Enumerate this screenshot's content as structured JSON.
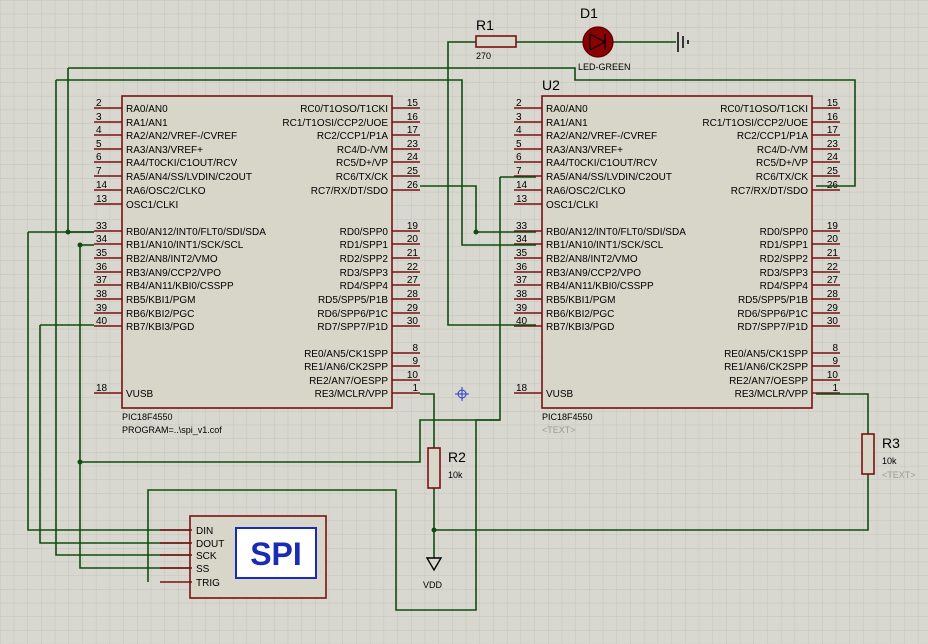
{
  "colors": {
    "background": "#d8d8d0",
    "grid": "#c2c3b8",
    "wire": "#0f4d0f",
    "component_outline": "#7a1010",
    "component_fill": "#d7d6c9",
    "led": "#8b0000",
    "spi_text": "#1a2bb5"
  },
  "u1": {
    "ref": "",
    "part": "PIC18F4550",
    "program": "PROGRAM=..\\spi_v1.cof",
    "left_pins": [
      {
        "num": "2",
        "label": "RA0/AN0"
      },
      {
        "num": "3",
        "label": "RA1/AN1"
      },
      {
        "num": "4",
        "label": "RA2/AN2/VREF-/CVREF"
      },
      {
        "num": "5",
        "label": "RA3/AN3/VREF+"
      },
      {
        "num": "6",
        "label": "RA4/T0CKI/C1OUT/RCV"
      },
      {
        "num": "7",
        "label": "RA5/AN4/SS/LVDIN/C2OUT"
      },
      {
        "num": "14",
        "label": "RA6/OSC2/CLKO"
      },
      {
        "num": "13",
        "label": "OSC1/CLKI"
      },
      {
        "num": "33",
        "label": "RB0/AN12/INT0/FLT0/SDI/SDA"
      },
      {
        "num": "34",
        "label": "RB1/AN10/INT1/SCK/SCL"
      },
      {
        "num": "35",
        "label": "RB2/AN8/INT2/VMO"
      },
      {
        "num": "36",
        "label": "RB3/AN9/CCP2/VPO"
      },
      {
        "num": "37",
        "label": "RB4/AN11/KBI0/CSSPP"
      },
      {
        "num": "38",
        "label": "RB5/KBI1/PGM"
      },
      {
        "num": "39",
        "label": "RB6/KBI2/PGC"
      },
      {
        "num": "40",
        "label": "RB7/KBI3/PGD"
      },
      {
        "num": "18",
        "label": "VUSB"
      }
    ],
    "right_pins": [
      {
        "num": "15",
        "label": "RC0/T1OSO/T1CKI"
      },
      {
        "num": "16",
        "label": "RC1/T1OSI/CCP2/UOE"
      },
      {
        "num": "17",
        "label": "RC2/CCP1/P1A"
      },
      {
        "num": "23",
        "label": "RC4/D-/VM"
      },
      {
        "num": "24",
        "label": "RC5/D+/VP"
      },
      {
        "num": "25",
        "label": "RC6/TX/CK"
      },
      {
        "num": "26",
        "label": "RC7/RX/DT/SDO"
      },
      {
        "num": "19",
        "label": "RD0/SPP0"
      },
      {
        "num": "20",
        "label": "RD1/SPP1"
      },
      {
        "num": "21",
        "label": "RD2/SPP2"
      },
      {
        "num": "22",
        "label": "RD3/SPP3"
      },
      {
        "num": "27",
        "label": "RD4/SPP4"
      },
      {
        "num": "28",
        "label": "RD5/SPP5/P1B"
      },
      {
        "num": "29",
        "label": "RD6/SPP6/P1C"
      },
      {
        "num": "30",
        "label": "RD7/SPP7/P1D"
      },
      {
        "num": "8",
        "label": "RE0/AN5/CK1SPP"
      },
      {
        "num": "9",
        "label": "RE1/AN6/CK2SPP"
      },
      {
        "num": "10",
        "label": "RE2/AN7/OESPP"
      },
      {
        "num": "1",
        "label": "RE3/MCLR/VPP"
      }
    ]
  },
  "u2": {
    "ref": "U2",
    "part": "PIC18F4550",
    "text": "<TEXT>"
  },
  "r1": {
    "ref": "R1",
    "value": "270"
  },
  "r2": {
    "ref": "R2",
    "value": "10k"
  },
  "r3": {
    "ref": "R3",
    "value": "10k",
    "text": "<TEXT>"
  },
  "d1": {
    "ref": "D1",
    "value": "LED-GREEN"
  },
  "vdd": {
    "label": "VDD"
  },
  "spi": {
    "title": "SPI",
    "pins": [
      "DIN",
      "DOUT",
      "SCK",
      "SS",
      "TRIG"
    ]
  }
}
